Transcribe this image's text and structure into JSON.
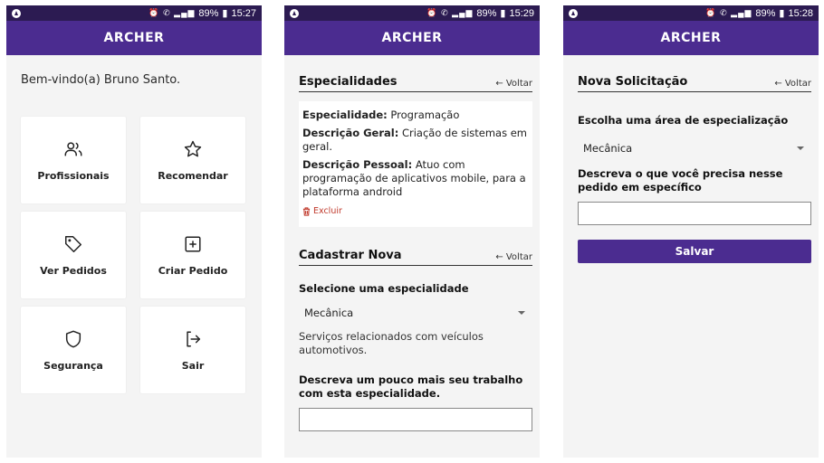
{
  "screens": [
    {
      "status": {
        "time": "15:27",
        "battery": "89%"
      },
      "app_title": "ARCHER",
      "welcome": "Bem-vindo(a) Bruno Santo.",
      "menu": [
        {
          "label": "Profissionais",
          "icon": "users-icon"
        },
        {
          "label": "Recomendar",
          "icon": "star-icon"
        },
        {
          "label": "Ver Pedidos",
          "icon": "tag-icon"
        },
        {
          "label": "Criar Pedido",
          "icon": "plus-square-icon"
        },
        {
          "label": "Segurança",
          "icon": "shield-icon"
        },
        {
          "label": "Sair",
          "icon": "logout-icon"
        }
      ]
    },
    {
      "status": {
        "time": "15:29",
        "battery": "89%"
      },
      "app_title": "ARCHER",
      "section_title": "Especialidades",
      "back_label": "← Voltar",
      "specialty": {
        "esp_label": "Especialidade:",
        "esp_value": " Programação",
        "geral_label": "Descrição Geral:",
        "geral_value": " Criação de sistemas em geral.",
        "pessoal_label": "Descrição Pessoal:",
        "pessoal_value": " Atuo com programação de aplicativos mobile, para a plataforma android",
        "delete_label": "Excluir"
      },
      "new_section_title": "Cadastrar Nova",
      "new_back_label": "← Voltar",
      "select_label": "Selecione uma especialidade",
      "select_value": "Mecânica",
      "select_desc": "Serviços relacionados com veículos automotivos.",
      "input_label": "Descreva um pouco mais seu trabalho com esta especialidade.",
      "input_value": ""
    },
    {
      "status": {
        "time": "15:28",
        "battery": "89%"
      },
      "app_title": "ARCHER",
      "section_title": "Nova Solicitação",
      "back_label": "← Voltar",
      "area_label": "Escolha uma área de especialização",
      "area_value": "Mecânica",
      "input_label": "Descreva o que você precisa nesse pedido em específico",
      "input_value": "",
      "save_label": "Salvar"
    }
  ],
  "colors": {
    "appbar": "#4b2c90",
    "statusbar": "#2c1b52",
    "delete": "#c0392b"
  }
}
